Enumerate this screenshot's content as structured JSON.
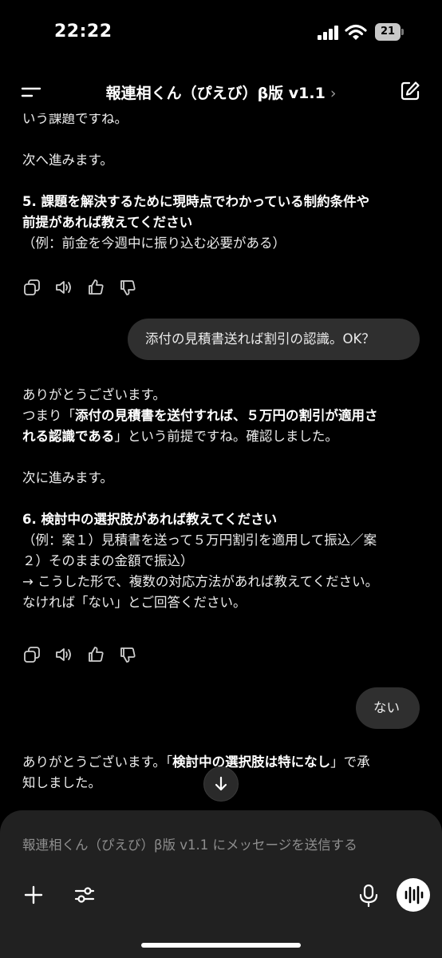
{
  "status": {
    "time": "22:22",
    "battery": "21"
  },
  "header": {
    "title": "報連相くん（ぴえび）β版 v1.1",
    "chevron": "›"
  },
  "messages": {
    "m1": {
      "line1": "いう課題ですね。",
      "line2": "次へ進みます。",
      "heading1": "5. 課題を解決するために現時点でわかっている制約条件や",
      "heading2": "前提があれば教えてください",
      "example": "（例：前金を今週中に振り込む必要がある）"
    },
    "u1": "添付の見積書送れば割引の認識。OK？",
    "m2": {
      "thanks": "ありがとうございます。",
      "p1": "つまり「",
      "bold1": "添付の見積書を送付すれば、５万円の割引が適用さ",
      "bold2": "れる認識である",
      "p2": "」という前提ですね。確認しました。",
      "next": "次に進みます。",
      "heading": "6. 検討中の選択肢があれば教えてください",
      "ex1": "（例：案１）見積書を送って５万円割引を適用して振込／案",
      "ex2": "２）そのままの金額で振込）",
      "arrow": "→ こうした形で、複数の対応方法があれば教えてください。",
      "last": "なければ「ない」とご回答ください。"
    },
    "u2": "ない",
    "m3": {
      "pre": "ありがとうございます。「",
      "bold": "検討中の選択肢は特になし",
      "post": "」で承",
      "line2": "知しました。"
    }
  },
  "composer": {
    "placeholder": "報連相くん（ぴえび）β版 v1.1 にメッセージを送信する"
  },
  "icons": [
    "menu-icon",
    "compose-icon",
    "copy-icon",
    "speaker-icon",
    "thumbs-up-icon",
    "thumbs-down-icon",
    "arrow-down-icon",
    "plus-icon",
    "sliders-icon",
    "mic-icon",
    "voice-wave-icon"
  ]
}
